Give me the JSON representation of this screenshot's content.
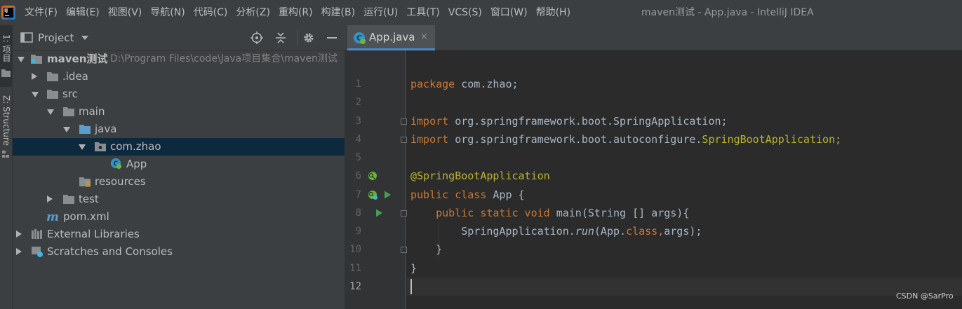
{
  "menubar": {
    "items": [
      "文件(F)",
      "编辑(E)",
      "视图(V)",
      "导航(N)",
      "代码(C)",
      "分析(Z)",
      "重构(R)",
      "构建(B)",
      "运行(U)",
      "工具(T)",
      "VCS(S)",
      "窗口(W)",
      "帮助(H)"
    ],
    "window_title": "maven测试 - App.java - IntelliJ IDEA"
  },
  "toolstrip": {
    "project_tab": "1: 项目",
    "structure_tab": "Z: Structure"
  },
  "project_panel": {
    "title": "Project",
    "tree": [
      {
        "label": "maven测试",
        "path": "D:\\Program Files\\code\\Java项目集合\\maven测试"
      },
      {
        "label": ".idea"
      },
      {
        "label": "src"
      },
      {
        "label": "main"
      },
      {
        "label": "java"
      },
      {
        "label": "com.zhao"
      },
      {
        "label": "App"
      },
      {
        "label": "resources"
      },
      {
        "label": "test"
      },
      {
        "label": "pom.xml"
      },
      {
        "label": "External Libraries"
      },
      {
        "label": "Scratches and Consoles"
      }
    ]
  },
  "editor": {
    "tab_label": "App.java",
    "tab_close": "×",
    "line_numbers": [
      "1",
      "2",
      "3",
      "4",
      "5",
      "6",
      "7",
      "8",
      "9",
      "10",
      "11",
      "12"
    ],
    "code": {
      "l1_kw": "package",
      "l1_rest": " com.zhao;",
      "l3_kw": "import",
      "l3_rest": " org.springframework.boot.SpringApplication;",
      "l4_kw": "import",
      "l4_rest": " org.springframework.boot.autoconfigure.",
      "l4_ann": "SpringBootApplication;",
      "l6_ann": "@SpringBootApplication",
      "l7_kw": "public class",
      "l7_rest": " App {",
      "l8_kw": "    public static void",
      "l8_rest": " main(String [] args){",
      "l9_a": "        SpringApplication.",
      "l9_it": "run",
      "l9_b": "(App.",
      "l9_kw": "class,",
      "l9_c": "args);",
      "l10": "    }",
      "l11": "}"
    }
  },
  "watermark": "CSDN @SarPro",
  "colors": {
    "keyword": "#cc7832",
    "annotation": "#bbb529",
    "text": "#a9b7c6",
    "selection": "#0d293e",
    "tab_underline": "#4a88c7"
  }
}
